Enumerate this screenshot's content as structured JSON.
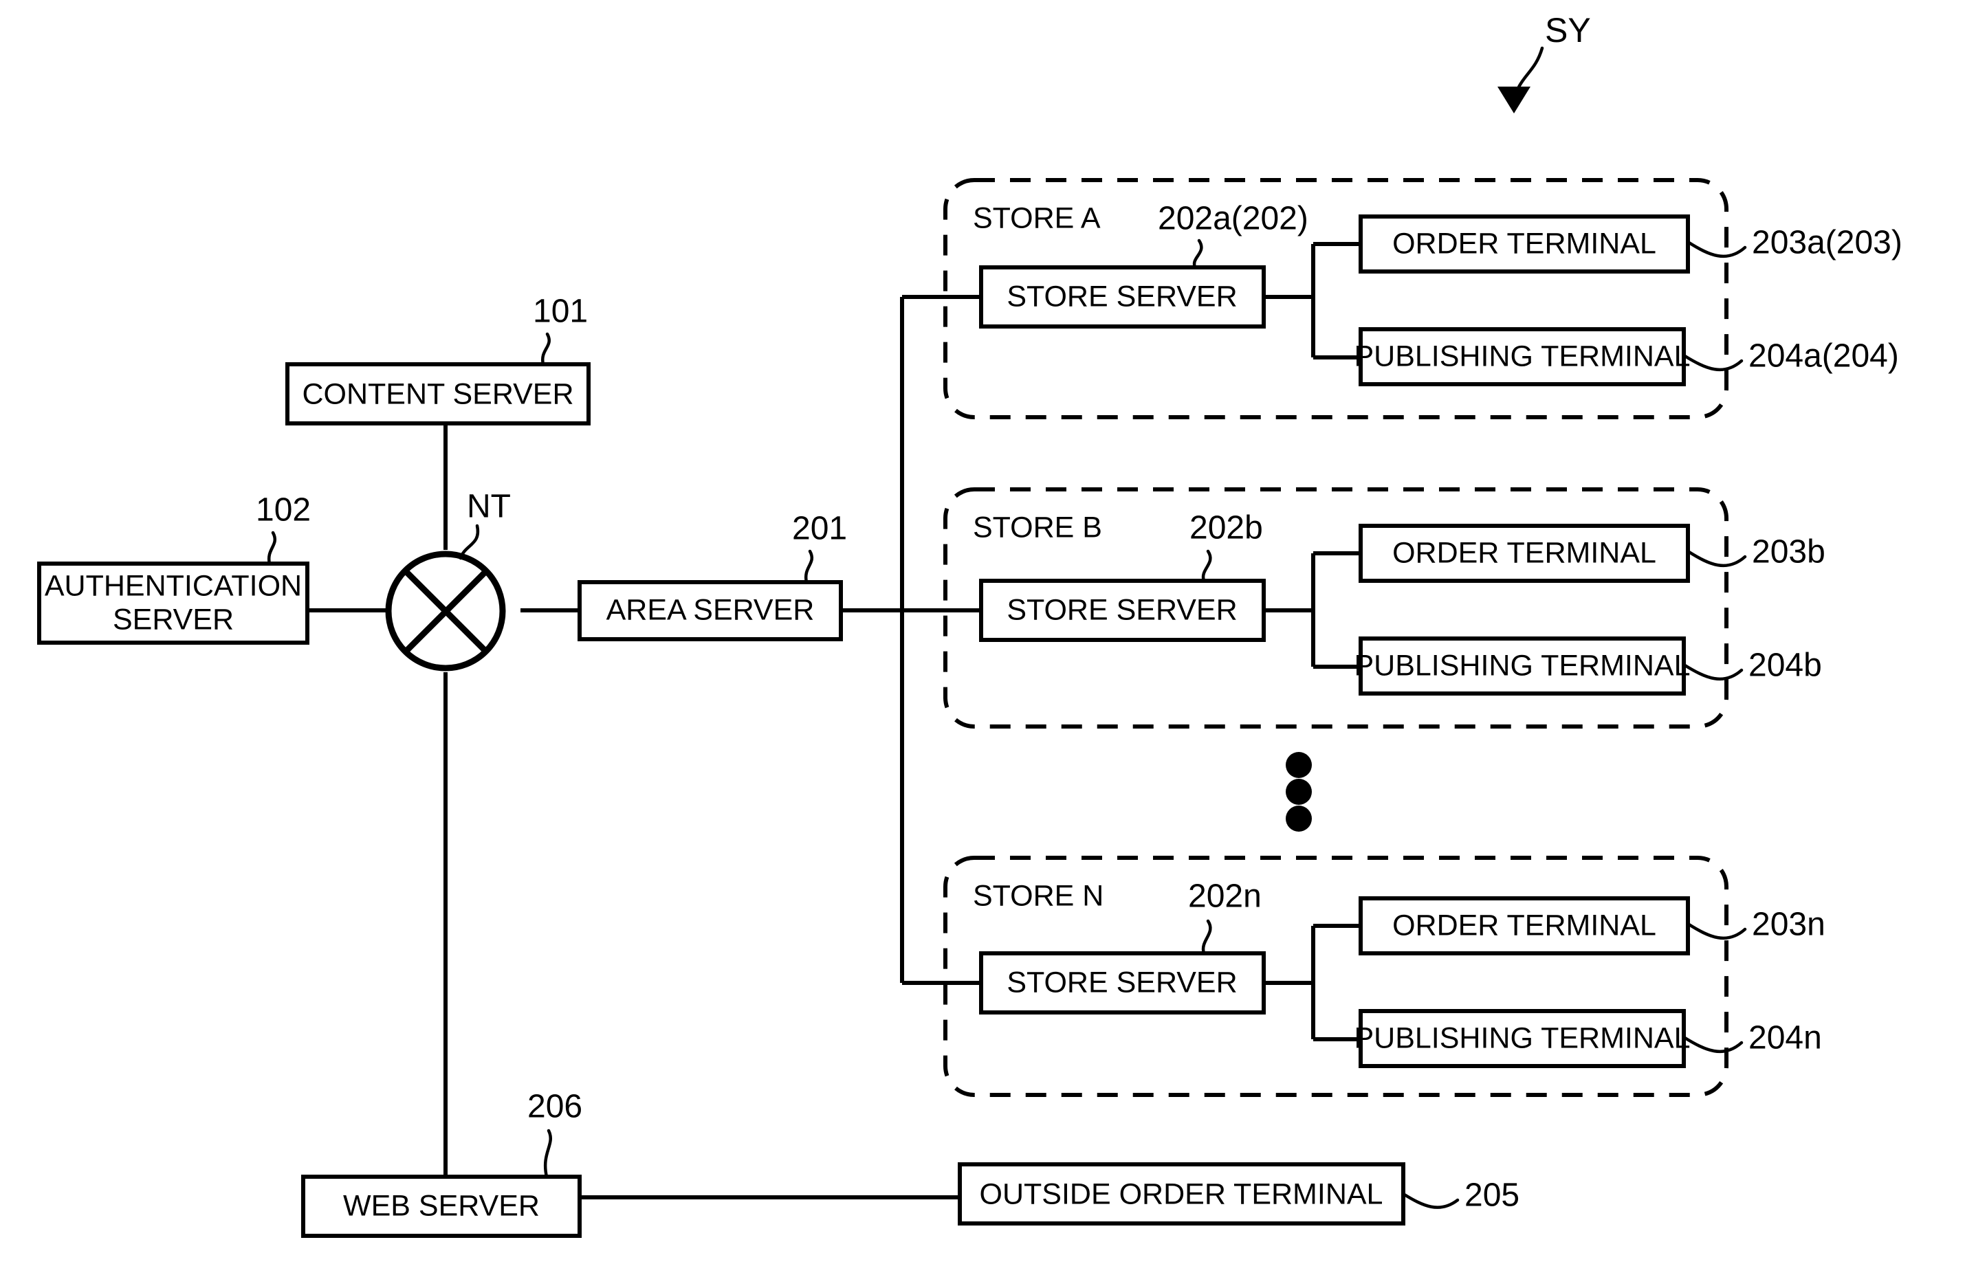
{
  "figure": {
    "system_label": "SY",
    "network_label": "NT"
  },
  "nodes": {
    "content_server": {
      "label": "CONTENT SERVER",
      "ref": "101"
    },
    "authentication_server": {
      "label": "AUTHENTICATION SERVER",
      "line1": "AUTHENTICATION",
      "line2": "SERVER",
      "ref": "102"
    },
    "area_server": {
      "label": "AREA SERVER",
      "ref": "201"
    },
    "web_server": {
      "label": "WEB SERVER",
      "ref": "206"
    },
    "outside_order_terminal": {
      "label": "OUTSIDE ORDER TERMINAL",
      "ref": "205"
    }
  },
  "stores": [
    {
      "name": "STORE A",
      "server_label": "STORE SERVER",
      "server_ref": "202a(202)",
      "order_terminal_label": "ORDER TERMINAL",
      "order_terminal_ref": "203a(203)",
      "publishing_terminal_label": "PUBLISHING TERMINAL",
      "publishing_terminal_ref": "204a(204)"
    },
    {
      "name": "STORE B",
      "server_label": "STORE SERVER",
      "server_ref": "202b",
      "order_terminal_label": "ORDER TERMINAL",
      "order_terminal_ref": "203b",
      "publishing_terminal_label": "PUBLISHING TERMINAL",
      "publishing_terminal_ref": "204b"
    },
    {
      "name": "STORE N",
      "server_label": "STORE SERVER",
      "server_ref": "202n",
      "order_terminal_label": "ORDER TERMINAL",
      "order_terminal_ref": "203n",
      "publishing_terminal_label": "PUBLISHING TERMINAL",
      "publishing_terminal_ref": "204n"
    }
  ],
  "colors": {
    "ink": "#000000",
    "paper": "#ffffff"
  }
}
